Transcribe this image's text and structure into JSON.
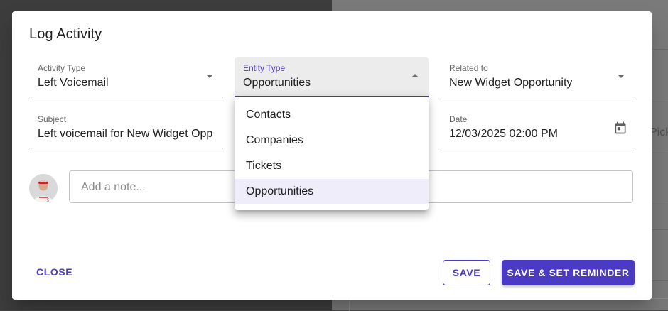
{
  "dialog": {
    "title": "Log Activity"
  },
  "fields": {
    "activity_type": {
      "label": "Activity Type",
      "value": "Left Voicemail"
    },
    "entity_type": {
      "label": "Entity Type",
      "value": "Opportunities"
    },
    "related_to": {
      "label": "Related to",
      "value": "New Widget Opportunity"
    },
    "subject": {
      "label": "Subject",
      "value": "Left voicemail for New Widget Opp"
    },
    "date": {
      "label": "Date",
      "value": "12/03/2025 02:00 PM"
    }
  },
  "note": {
    "placeholder": "Add a note..."
  },
  "entity_menu": {
    "items": [
      {
        "label": "Contacts"
      },
      {
        "label": "Companies"
      },
      {
        "label": "Tickets"
      },
      {
        "label": "Opportunities",
        "selected": true
      }
    ]
  },
  "actions": {
    "close": "CLOSE",
    "save": "SAVE",
    "save_reminder": "SAVE & SET REMINDER"
  },
  "background": {
    "partial_text": "Pick"
  },
  "colors": {
    "accent": "#4b3ac4",
    "menu_selected": "#efedf9"
  }
}
